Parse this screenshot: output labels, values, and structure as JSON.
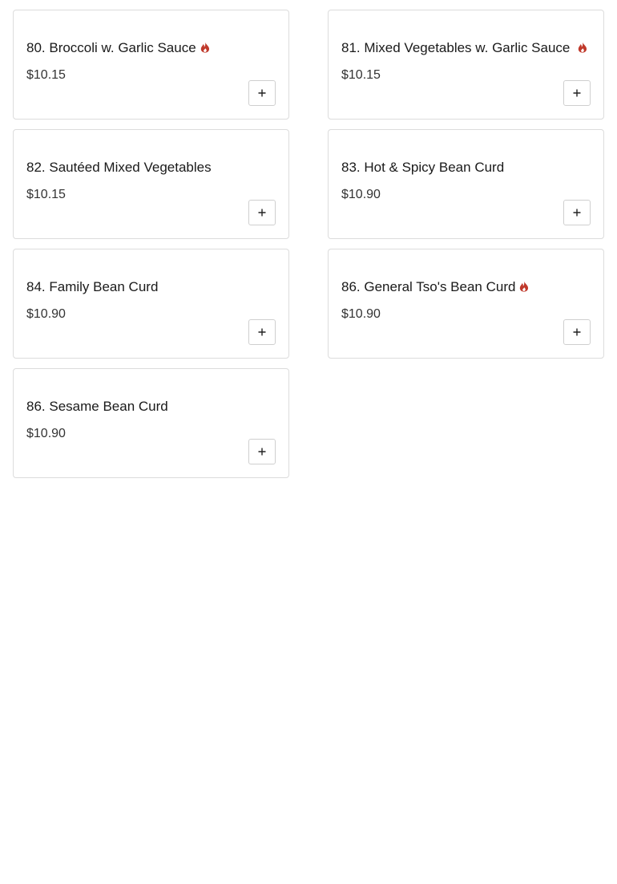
{
  "menu": {
    "items": [
      {
        "name": "80. Broccoli w. Garlic Sauce",
        "price": "$10.15",
        "spicy": true
      },
      {
        "name": "81. Mixed Vegetables w. Garlic Sauce",
        "price": "$10.15",
        "spicy": true
      },
      {
        "name": "82. Sautéed Mixed Vegetables",
        "price": "$10.15",
        "spicy": false
      },
      {
        "name": "83. Hot & Spicy Bean Curd",
        "price": "$10.90",
        "spicy": false
      },
      {
        "name": "84. Family Bean Curd",
        "price": "$10.90",
        "spicy": false
      },
      {
        "name": "86. General Tso's Bean Curd",
        "price": "$10.90",
        "spicy": true
      },
      {
        "name": "86. Sesame Bean Curd",
        "price": "$10.90",
        "spicy": false
      }
    ]
  },
  "icons": {
    "spicy": "flame-icon",
    "add": "plus-icon"
  },
  "colors": {
    "spicy": "#c0392b",
    "border": "#dcdcdc"
  }
}
